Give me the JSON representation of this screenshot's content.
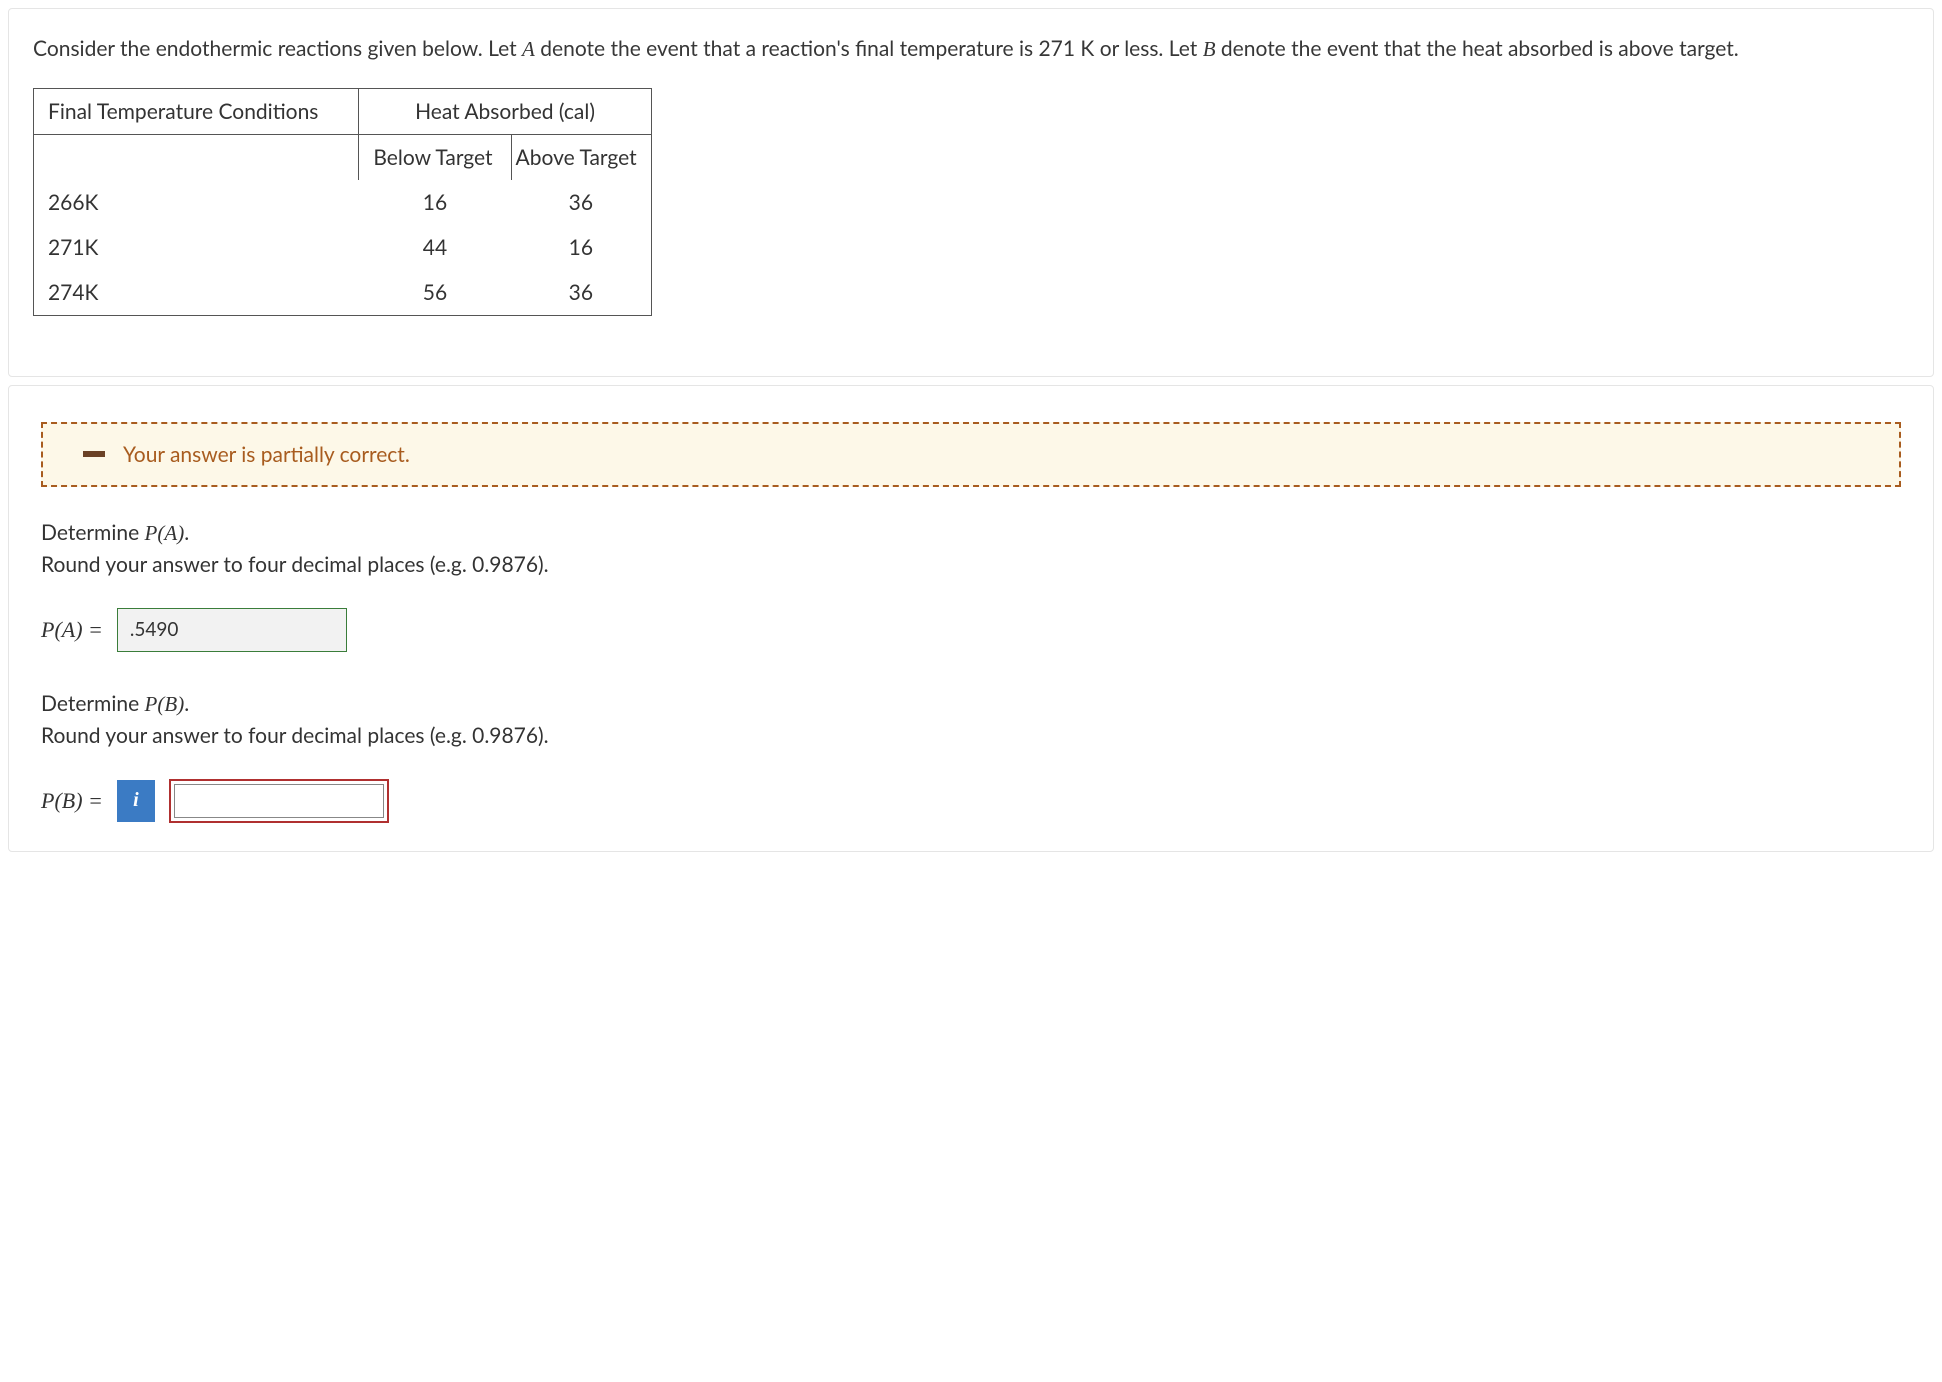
{
  "question": {
    "prefix": "Consider the endothermic reactions given below. Let ",
    "varA": "A",
    "mid1": " denote the event that a reaction's final temperature is 271 K or less. Let ",
    "varB": "B",
    "suffix": " denote the event that the heat absorbed is above target."
  },
  "table": {
    "header_left": "Final Temperature Conditions",
    "header_right": "Heat Absorbed (cal)",
    "sub_left": "Below Target",
    "sub_right": "Above Target",
    "rows": [
      {
        "label": "266K",
        "below": "16",
        "above": "36"
      },
      {
        "label": "271K",
        "below": "44",
        "above": "16"
      },
      {
        "label": "274K",
        "below": "56",
        "above": "36"
      }
    ]
  },
  "feedback": {
    "text": "Your answer is partially correct."
  },
  "partA": {
    "prompt_prefix": "Determine ",
    "prompt_var": "P(A)",
    "prompt_suffix": ".",
    "round_text": "Round your answer to four decimal places (e.g. 0.9876).",
    "label": "P(A) =",
    "value": ".5490"
  },
  "partB": {
    "prompt_prefix": "Determine ",
    "prompt_var": "P(B)",
    "prompt_suffix": ".",
    "round_text": "Round your answer to four decimal places (e.g. 0.9876).",
    "label": "P(B) =",
    "info": "i",
    "value": ""
  },
  "chart_data": {
    "type": "table",
    "title": "Heat Absorbed (cal) by Final Temperature Conditions",
    "columns": [
      "Final Temperature Conditions",
      "Below Target",
      "Above Target"
    ],
    "rows": [
      [
        "266K",
        16,
        36
      ],
      [
        "271K",
        44,
        16
      ],
      [
        "274K",
        56,
        36
      ]
    ]
  }
}
